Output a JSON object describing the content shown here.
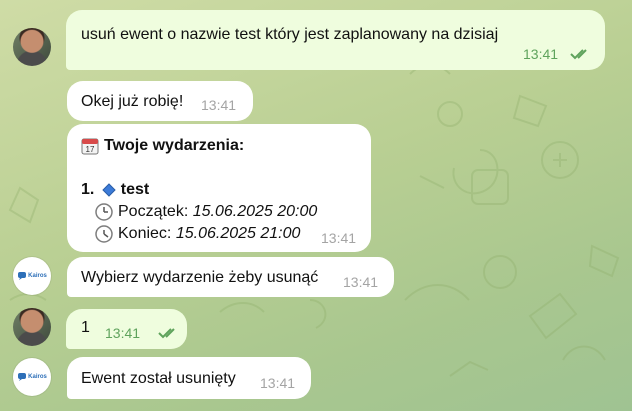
{
  "messages": {
    "m1": {
      "text": "usuń ewent o nazwie test który jest zaplanowany na dzisiaj",
      "time": "13:41"
    },
    "m2": {
      "text": "Okej już robię!",
      "time": "13:41"
    },
    "m3": {
      "heading": "Twoje wydarzenia:",
      "item_number": "1.",
      "item_name": "test",
      "start_label": "Początek:",
      "start_value": "15.06.2025 20:00",
      "end_label": "Koniec:",
      "end_value": "15.06.2025 21:00",
      "time": "13:41"
    },
    "m4": {
      "text": "Wybierz wydarzenie żeby usunąć",
      "time": "13:41"
    },
    "m5": {
      "text": "1",
      "time": "13:41"
    },
    "m6": {
      "text": "Ewent został usunięty",
      "time": "13:41"
    }
  },
  "bot_avatar_label": "Kairos",
  "colors": {
    "outgoing_bubble": "#effdde",
    "incoming_bubble": "#ffffff",
    "checkmark": "#5fa35c"
  }
}
